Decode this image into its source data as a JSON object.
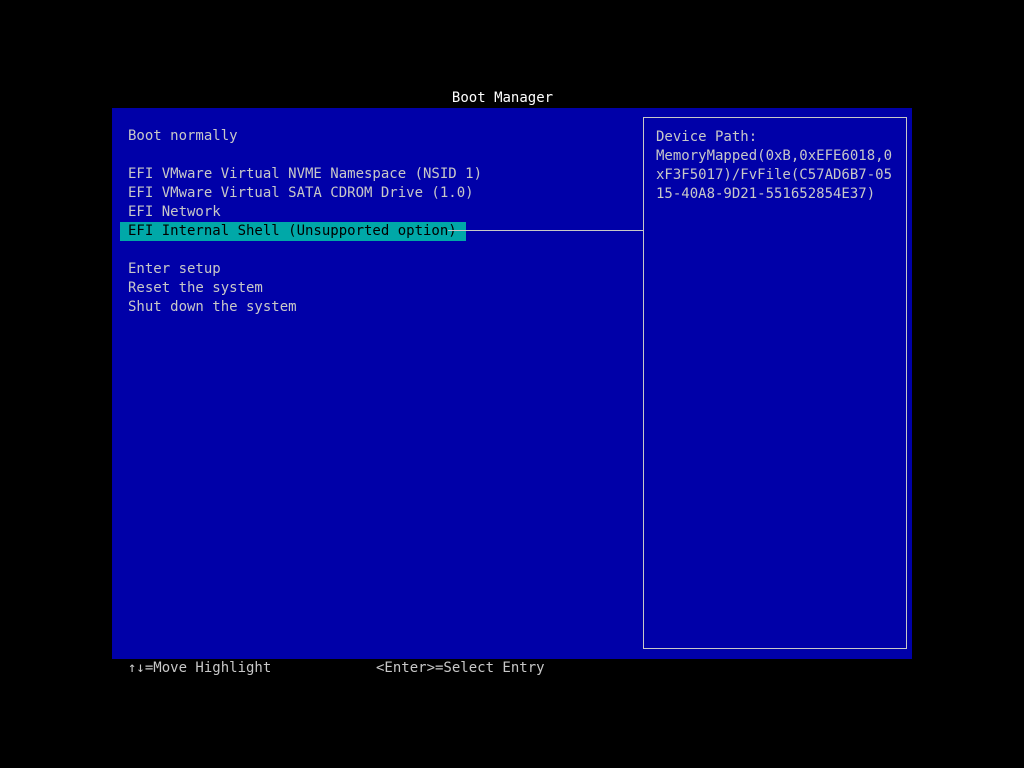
{
  "title": "Boot Manager",
  "menu": {
    "items": [
      {
        "label": "Boot normally",
        "selected": false
      },
      {
        "label": "EFI VMware Virtual NVME Namespace (NSID 1)",
        "selected": false
      },
      {
        "label": "EFI VMware Virtual SATA CDROM Drive (1.0)",
        "selected": false
      },
      {
        "label": "EFI Network",
        "selected": false
      },
      {
        "label": "EFI Internal Shell (Unsupported option)",
        "selected": true
      },
      {
        "label": "Enter setup",
        "selected": false
      },
      {
        "label": "Reset the system",
        "selected": false
      },
      {
        "label": "Shut down the system",
        "selected": false
      }
    ]
  },
  "device_path": {
    "label": "Device Path:",
    "value": "MemoryMapped(0xB,0xEFE6018,0xF3F5017)/FvFile(C57AD6B7-0515-40A8-9D21-551652854E37)"
  },
  "help": {
    "move": "↑↓=Move Highlight",
    "select": "<Enter>=Select Entry"
  },
  "colors": {
    "background": "#000000",
    "panel": "#0000a8",
    "highlight": "#00a8a8",
    "text": "#c8c8c8",
    "title": "#ffffff"
  }
}
